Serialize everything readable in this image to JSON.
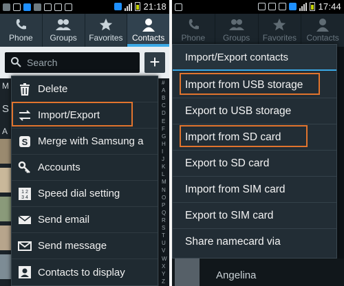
{
  "left": {
    "status": {
      "time": "21:18",
      "battery_color": "#c8d400"
    },
    "tabs": [
      {
        "label": "Phone",
        "icon": "phone-icon",
        "active": false
      },
      {
        "label": "Groups",
        "icon": "groups-icon",
        "active": false
      },
      {
        "label": "Favorites",
        "icon": "star-icon",
        "active": false
      },
      {
        "label": "Contacts",
        "icon": "contact-icon",
        "active": true
      }
    ],
    "search": {
      "placeholder": "Search",
      "add_label": "+"
    },
    "side_letters": [
      "M",
      "S",
      "A"
    ],
    "index_letters": [
      "#",
      "A",
      "B",
      "C",
      "D",
      "E",
      "F",
      "G",
      "H",
      "I",
      "J",
      "K",
      "L",
      "M",
      "N",
      "O",
      "P",
      "Q",
      "R",
      "S",
      "T",
      "U",
      "V",
      "W",
      "X",
      "Y",
      "Z"
    ],
    "menu": [
      {
        "label": "Delete",
        "icon": "trash-icon",
        "highlighted": false
      },
      {
        "label": "Import/Export",
        "icon": "import-export-icon",
        "highlighted": true
      },
      {
        "label": "Merge with Samsung a",
        "icon": "samsung-account-icon",
        "highlighted": false
      },
      {
        "label": "Accounts",
        "icon": "key-icon",
        "highlighted": false
      },
      {
        "label": "Speed dial setting",
        "icon": "speed-dial-icon",
        "highlighted": false
      },
      {
        "label": "Send email",
        "icon": "email-icon",
        "highlighted": false
      },
      {
        "label": "Send message",
        "icon": "message-icon",
        "highlighted": false
      },
      {
        "label": "Contacts to display",
        "icon": "contacts-display-icon",
        "highlighted": false
      }
    ]
  },
  "right": {
    "status": {
      "time": "17:44"
    },
    "tabs": [
      {
        "label": "Phone",
        "icon": "phone-icon"
      },
      {
        "label": "Groups",
        "icon": "groups-icon"
      },
      {
        "label": "Favorites",
        "icon": "star-icon"
      },
      {
        "label": "Contacts",
        "icon": "contact-icon"
      }
    ],
    "dialog": {
      "title": "Import/Export contacts",
      "items": [
        {
          "label": "Import from USB storage",
          "highlighted": true
        },
        {
          "label": "Export to USB storage",
          "highlighted": false
        },
        {
          "label": "Import from SD card",
          "highlighted": true
        },
        {
          "label": "Export to SD card",
          "highlighted": false
        },
        {
          "label": "Import from SIM card",
          "highlighted": false
        },
        {
          "label": "Export to SIM card",
          "highlighted": false
        },
        {
          "label": "Share namecard via",
          "highlighted": false
        }
      ]
    },
    "contact_below": "Angelina"
  },
  "colors": {
    "accent": "#3ba9e6",
    "highlight": "#e2742d",
    "menu_bg": "#1f2a31"
  }
}
